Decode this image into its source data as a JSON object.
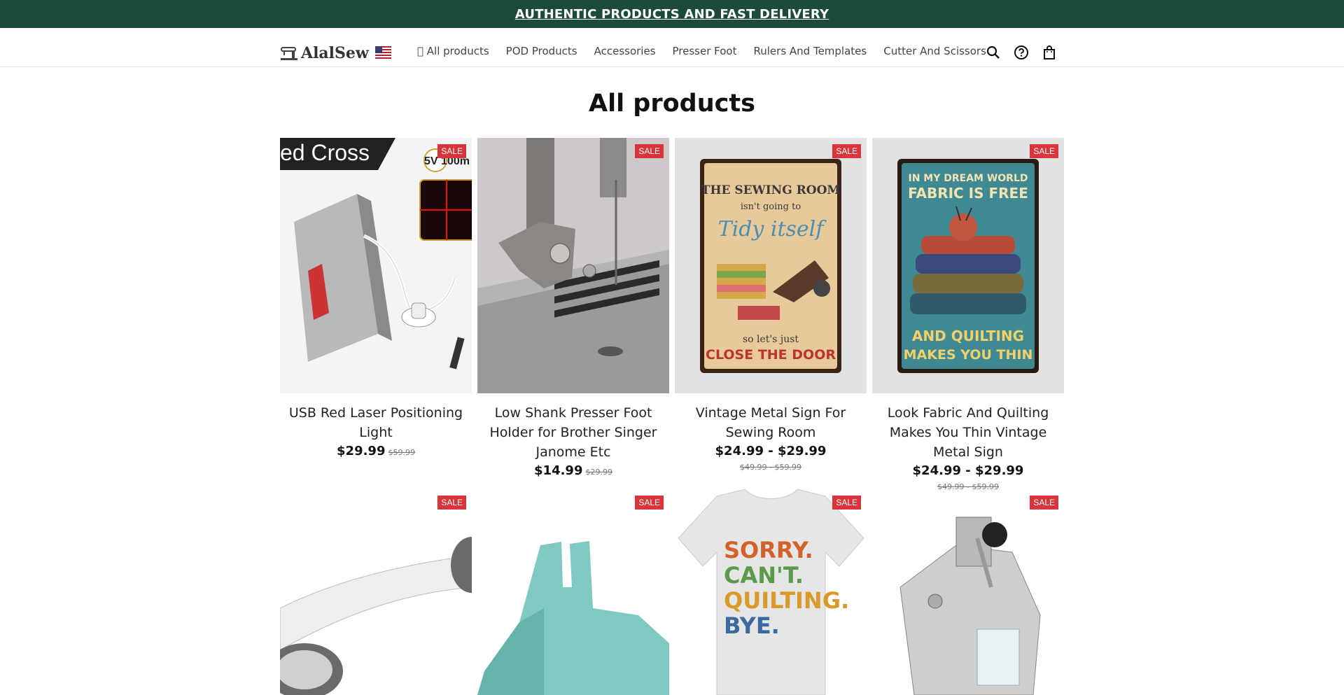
{
  "announcement": "AUTHENTIC PRODUCTS AND FAST DELIVERY",
  "brand": {
    "name": "AlalSew"
  },
  "nav": [
    "\u0000 All products",
    "POD Products",
    "Accessories",
    "Presser Foot",
    "Rulers And Templates",
    "Cutter And Scissors"
  ],
  "page_title": "All products",
  "sale_badge": "SALE",
  "products_row1": [
    {
      "name": "USB Red Laser Positioning Light",
      "price": "$29.99",
      "compare": "$59.99"
    },
    {
      "name": "Low Shank Presser Foot Holder for Brother Singer Janome Etc",
      "price": "$14.99",
      "compare": "$29.99"
    },
    {
      "name": "Vintage Metal Sign For Sewing Room",
      "price": "$24.99 - $29.99",
      "compare": "$49.99 - $59.99"
    },
    {
      "name": "Look Fabric And Quilting Makes You Thin Vintage Metal Sign",
      "price": "$24.99 - $29.99",
      "compare": "$49.99 - $59.99"
    }
  ],
  "images": {
    "laser_banner": "ed Cross",
    "laser_badge": "5V 100m",
    "sign1_top": "THE SEWING ROOM",
    "sign1_mid": "isn't going to",
    "sign1_script": "Tidy itself",
    "sign1_low": "so let's just",
    "sign1_bottom": "CLOSE THE DOOR",
    "sign2_top": "IN MY DREAM WORLD",
    "sign2_top2": "FABRIC IS FREE",
    "sign2_bottom": "AND QUILTING",
    "sign2_bottom2": "MAKES YOU THIN",
    "shirt_l1": "SORRY.",
    "shirt_l2": "CAN'T.",
    "shirt_l3": "QUILTING.",
    "shirt_l4": "BYE."
  },
  "colors": {
    "announce_bg": "#1c4a3b",
    "sale_red": "#d8343b"
  }
}
